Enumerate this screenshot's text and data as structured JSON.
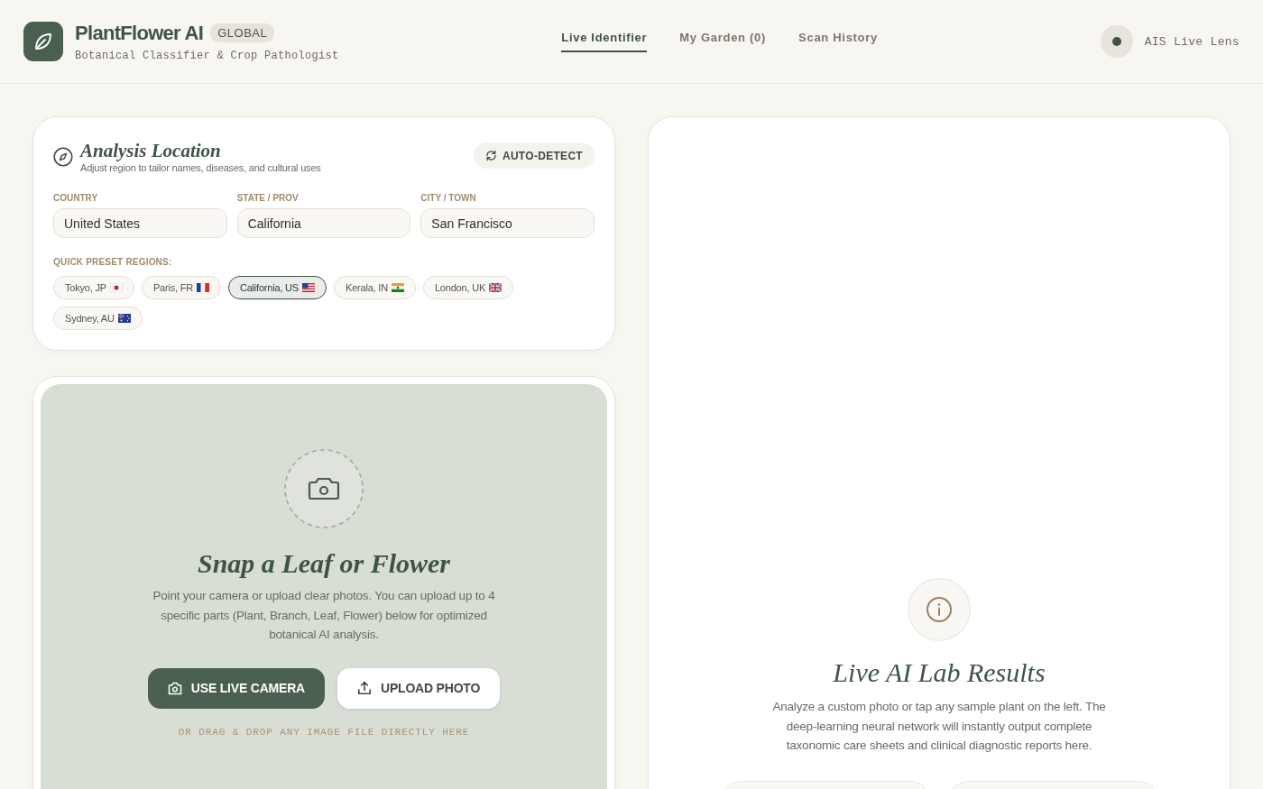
{
  "header": {
    "title": "PlantFlower AI",
    "badge": "GLOBAL",
    "subtitle": "Botanical Classifier & Crop Pathologist"
  },
  "nav_tabs": [
    {
      "label": "Live Identifier",
      "selected": true
    },
    {
      "label": "My Garden (0)",
      "selected": false
    },
    {
      "label": "Scan History",
      "selected": false
    }
  ],
  "status": {
    "label": "AIS Live Lens"
  },
  "location": {
    "title": "Analysis Location",
    "subtitle": "Adjust region to tailor names, diseases, and cultural uses",
    "auto_detect_button": "AUTO-DETECT",
    "fields": [
      {
        "label": "COUNTRY",
        "value": "United States"
      },
      {
        "label": "STATE / PROV",
        "value": "California"
      },
      {
        "label": "CITY / TOWN",
        "value": "San Francisco"
      }
    ],
    "presets_label": "QUICK PRESET REGIONS:",
    "presets": [
      {
        "label": "Tokyo, JP",
        "kind": "jp",
        "selected": false
      },
      {
        "label": "Paris, FR",
        "kind": "fr",
        "selected": false
      },
      {
        "label": "California, US",
        "kind": "us",
        "selected": true
      },
      {
        "label": "Kerala, IN",
        "kind": "in",
        "selected": false
      },
      {
        "label": "London, UK",
        "kind": "uk",
        "selected": false
      },
      {
        "label": "Sydney, AU",
        "kind": "au",
        "selected": false
      }
    ]
  },
  "upload": {
    "title": "Snap a Leaf or Flower",
    "description": "Point your camera or upload clear photos. You can upload up to 4 specific parts (Plant, Branch, Leaf, Flower) below for optimized botanical AI analysis.",
    "buttons": [
      {
        "label": "USE LIVE CAMERA",
        "kind": "primary"
      },
      {
        "label": "UPLOAD PHOTO",
        "kind": "secondary"
      }
    ],
    "drop_hint": "OR DRAG & DROP ANY IMAGE FILE DIRECTLY HERE"
  },
  "results": {
    "title": "Live AI Lab Results",
    "description": "Analyze a custom photo or tap any sample plant on the left. The deep-learning neural network will instantly output complete taxonomic care sheets and clinical diagnostic reports here."
  }
}
